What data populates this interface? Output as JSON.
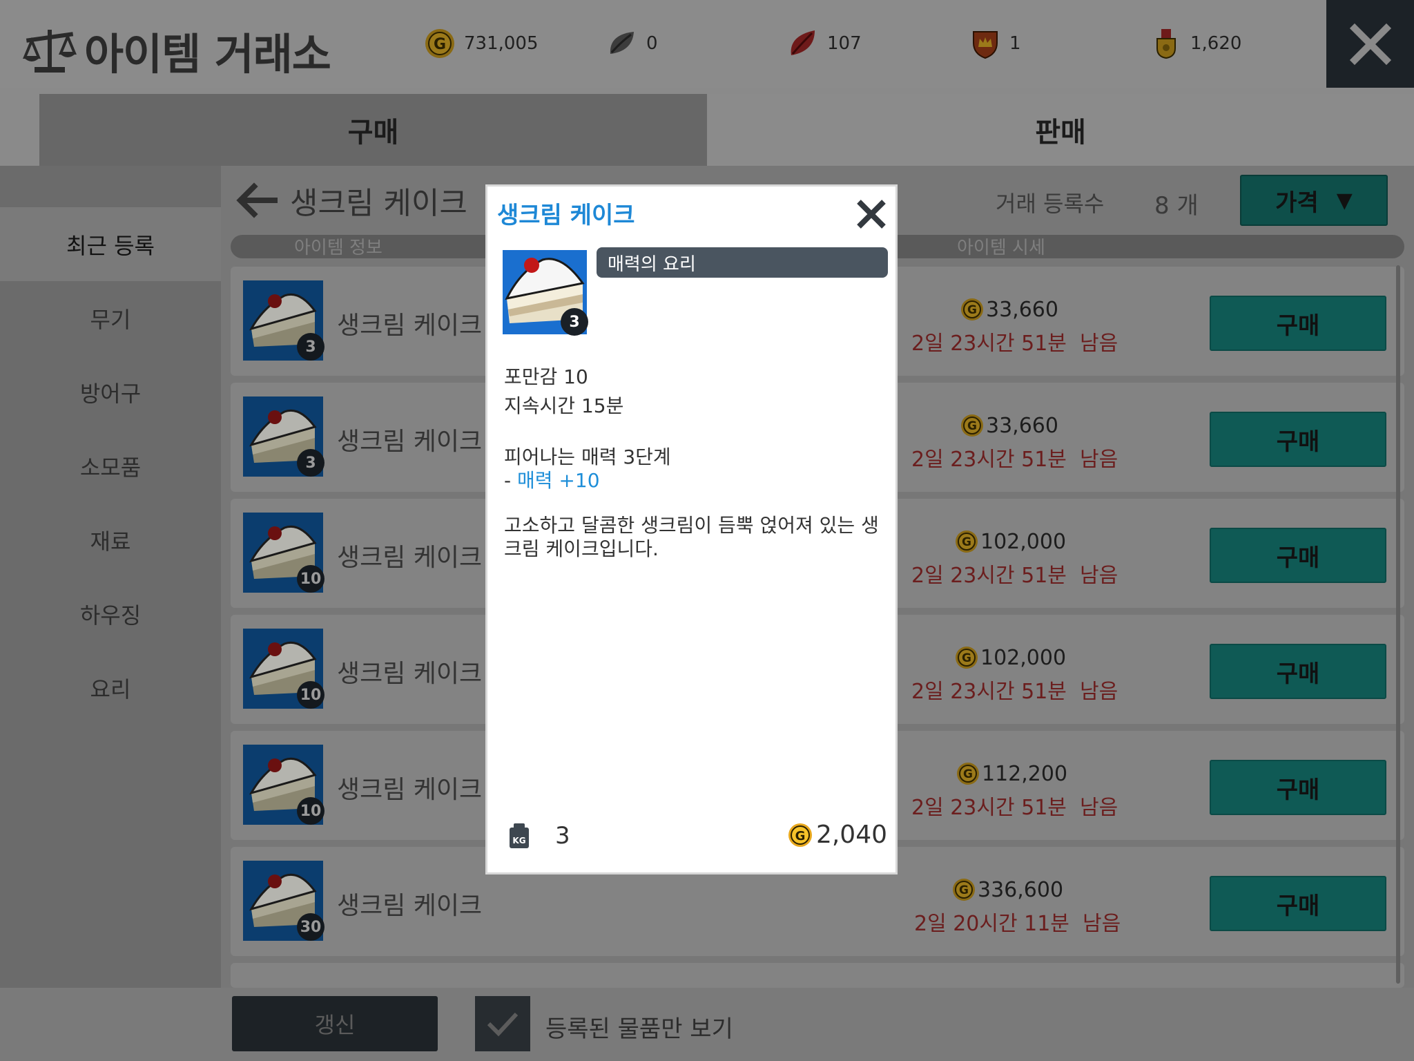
{
  "header": {
    "title": "아이템 거래소",
    "currencies": [
      {
        "icon": "gold-coin-icon",
        "value": "731,005"
      },
      {
        "icon": "gray-leaf-icon",
        "value": "0"
      },
      {
        "icon": "red-leaf-icon",
        "value": "107"
      },
      {
        "icon": "crown-shield-icon",
        "value": "1"
      },
      {
        "icon": "medal-icon",
        "value": "1,620"
      }
    ]
  },
  "tabs": [
    {
      "label": "구매",
      "active": true
    },
    {
      "label": "판매",
      "active": false
    }
  ],
  "sidebar": {
    "items": [
      {
        "label": "최근 등록",
        "active": true
      },
      {
        "label": "무기"
      },
      {
        "label": "방어구"
      },
      {
        "label": "소모품"
      },
      {
        "label": "재료"
      },
      {
        "label": "하우징"
      },
      {
        "label": "요리"
      }
    ]
  },
  "listing": {
    "category_title": "생크림 케이크",
    "count_label": "거래 등록수",
    "count_value": "8 개",
    "sort_label": "가격",
    "col_item_info": "아이템 정보",
    "col_market_price": "아이템 시세",
    "buy_label": "구매",
    "rows": [
      {
        "name": "생크림 케이크",
        "qty": "3",
        "price": "33,660",
        "time": "2일 23시간 51분  남음"
      },
      {
        "name": "생크림 케이크",
        "qty": "3",
        "price": "33,660",
        "time": "2일 23시간 51분  남음"
      },
      {
        "name": "생크림 케이크",
        "qty": "10",
        "price": "102,000",
        "time": "2일 23시간 51분  남음"
      },
      {
        "name": "생크림 케이크",
        "qty": "10",
        "price": "102,000",
        "time": "2일 23시간 51분  남음"
      },
      {
        "name": "생크림 케이크",
        "qty": "10",
        "price": "112,200",
        "time": "2일 23시간 51분  남음"
      },
      {
        "name": "생크림 케이크",
        "qty": "30",
        "price": "336,600",
        "time": "2일 20시간 11분  남음"
      }
    ]
  },
  "bottom": {
    "refresh_label": "갱신",
    "filter_label": "등록된 물품만 보기",
    "filter_checked": true
  },
  "popup": {
    "title": "생크림 케이크",
    "qty": "3",
    "category": "매력의 요리",
    "stat1": "포만감  10",
    "stat2": "지속시간  15분",
    "effect_title": "피어나는 매력 3단계",
    "effect_prefix": "- ",
    "effect_value": "매력  +10",
    "description": "고소하고 달콤한 생크림이 듬뿍 얹어져 있는 생크림 케이크입니다.",
    "weight": "3",
    "price": "2,040"
  },
  "colors": {
    "accent_blue": "#1e88d6",
    "buy_button": "#0f5a55",
    "time_red": "#6b1e1e"
  }
}
